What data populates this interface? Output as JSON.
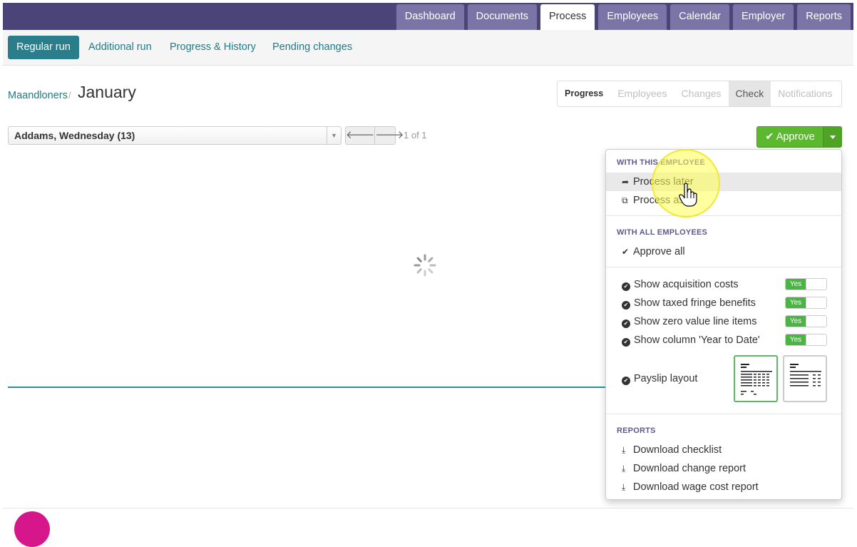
{
  "topnav": {
    "tabs": [
      {
        "label": "Dashboard",
        "active": false
      },
      {
        "label": "Documents",
        "active": false
      },
      {
        "label": "Process",
        "active": true
      },
      {
        "label": "Employees",
        "active": false
      },
      {
        "label": "Calendar",
        "active": false
      },
      {
        "label": "Employer",
        "active": false
      },
      {
        "label": "Reports",
        "active": false
      }
    ]
  },
  "subnav": {
    "links": [
      {
        "label": "Regular run",
        "active": true
      },
      {
        "label": "Additional run",
        "active": false
      },
      {
        "label": "Progress & History",
        "active": false
      },
      {
        "label": "Pending changes",
        "active": false
      }
    ]
  },
  "breadcrumb": {
    "parent": "Maandloners",
    "separator": "/",
    "title": "January"
  },
  "steps": {
    "tabs": [
      {
        "label": "Progress",
        "state": "bold"
      },
      {
        "label": "Employees",
        "state": "disabled"
      },
      {
        "label": "Changes",
        "state": "disabled"
      },
      {
        "label": "Check",
        "state": "active"
      },
      {
        "label": "Notifications",
        "state": "disabled"
      }
    ]
  },
  "employee_select": {
    "value": "Addams, Wednesday (13)"
  },
  "pager": {
    "text": "1 of 1",
    "prev_icon": "arrow-left-icon",
    "next_icon": "arrow-right-icon"
  },
  "approve": {
    "label": "Approve",
    "icon": "check-icon",
    "color": "#5cb82f"
  },
  "dropdown": {
    "section_employee": "WITH THIS EMPLOYEE",
    "process_later": "Process later",
    "process_as": "Process as",
    "section_all": "WITH ALL EMPLOYEES",
    "approve_all": "Approve all",
    "options": [
      {
        "label": "Show acquisition costs",
        "toggle": "Yes"
      },
      {
        "label": "Show taxed fringe benefits",
        "toggle": "Yes"
      },
      {
        "label": "Show zero value line items",
        "toggle": "Yes"
      },
      {
        "label": "Show column 'Year to Date'",
        "toggle": "Yes"
      }
    ],
    "payslip_layout": "Payslip layout",
    "section_reports": "REPORTS",
    "reports": [
      "Download checklist",
      "Download change report",
      "Download wage cost report"
    ]
  },
  "colors": {
    "nav_bg": "#4a4478",
    "nav_tab": "#7a75a6",
    "teal": "#2a7d8a",
    "green": "#5cb82f",
    "section_header": "#5e5a8a"
  }
}
